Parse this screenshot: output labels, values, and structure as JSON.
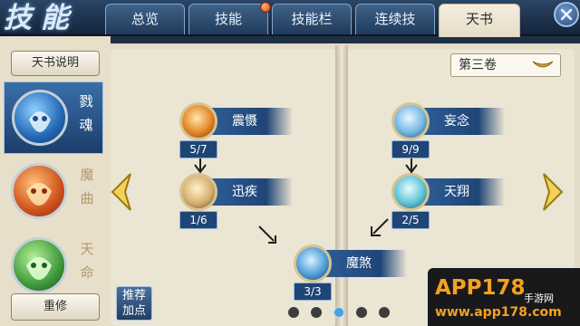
{
  "header": {
    "logo_text": "技能",
    "tabs": [
      {
        "label": "总览"
      },
      {
        "label": "技能",
        "has_notification": true
      },
      {
        "label": "技能栏"
      },
      {
        "label": "连续技"
      },
      {
        "label": "天书",
        "active": true
      }
    ]
  },
  "left_panel": {
    "explain_button": "天书说明",
    "items": [
      {
        "label": "戮魂",
        "icon": "blue-dragon-mask-icon",
        "active": true
      },
      {
        "label": "魔曲",
        "icon": "orange-lion-mask-icon",
        "active": false
      },
      {
        "label": "天命",
        "icon": "green-dragon-mask-icon",
        "active": false
      }
    ],
    "reset_button": "重修"
  },
  "book": {
    "volume_selected": "第三卷",
    "skills": [
      {
        "name": "震慑",
        "count": "5/7",
        "icon": "fire-burst-icon"
      },
      {
        "name": "迅疾",
        "count": "1/6",
        "icon": "wind-icon"
      },
      {
        "name": "魔煞",
        "count": "3/3",
        "icon": "lightning-icon"
      },
      {
        "name": "妄念",
        "count": "9/9",
        "icon": "ice-crystal-icon"
      },
      {
        "name": "天翔",
        "count": "2/5",
        "icon": "wave-icon"
      }
    ],
    "recommend_button": "推荐加点",
    "pagination": {
      "total": 5,
      "current": 3
    }
  },
  "colors": {
    "accent_blue": "#1f4576",
    "parchment": "#ebe5d4",
    "gold": "#f0c040"
  },
  "watermark": {
    "main": "APP178",
    "sub": "手游网",
    "url": "www.app178.com"
  }
}
